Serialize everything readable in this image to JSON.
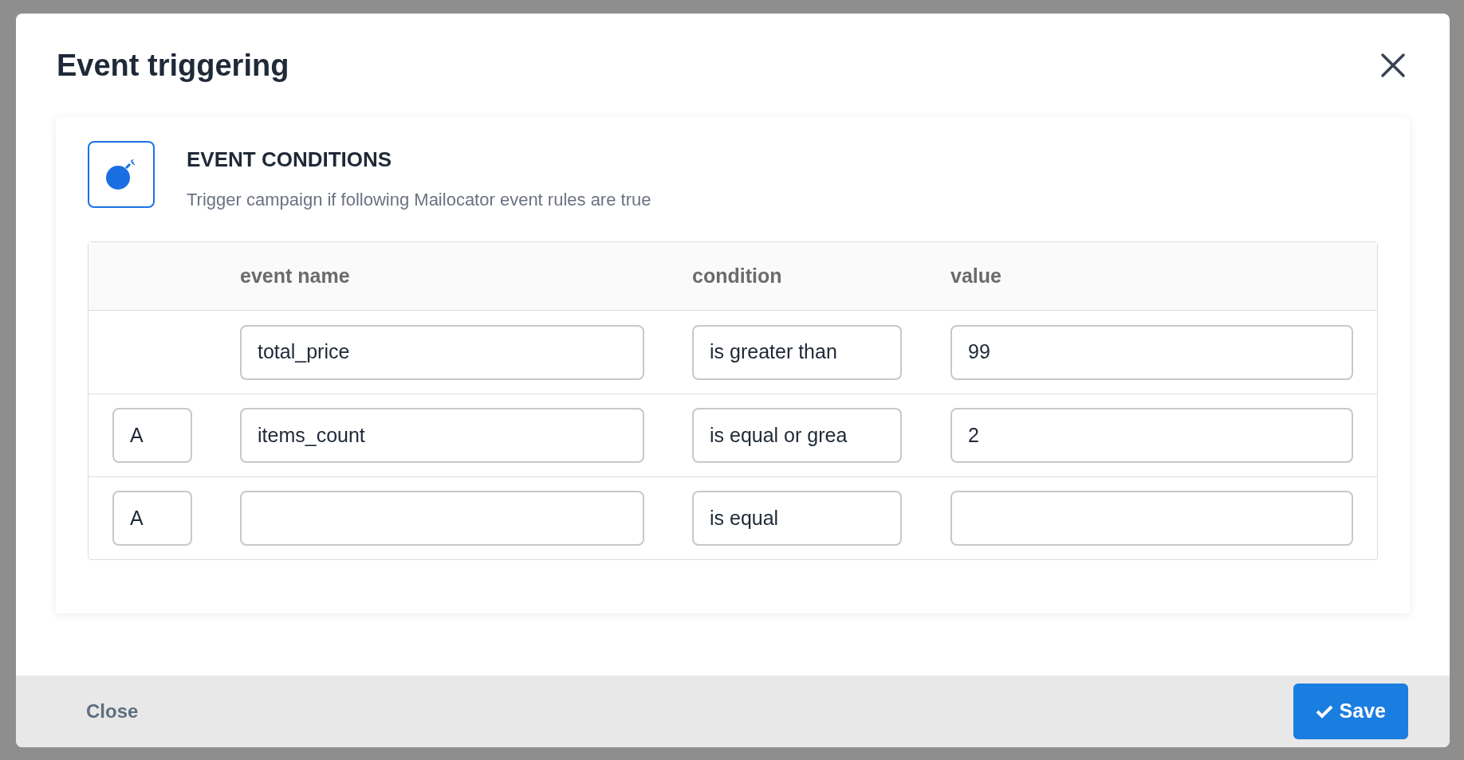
{
  "dialog": {
    "title": "Event triggering"
  },
  "section": {
    "title": "EVENT CONDITIONS",
    "description": "Trigger campaign if following Mailocator event rules are true"
  },
  "table": {
    "columns": [
      "event name",
      "condition",
      "value"
    ],
    "rows": [
      {
        "event_name": "total_price",
        "condition": "is greater than",
        "value": "99"
      },
      {
        "operator": "A",
        "event_name": "items_count",
        "condition": "is equal or grea",
        "value": "2"
      },
      {
        "operator": "A",
        "condition": "is equal"
      }
    ]
  },
  "footer": {
    "close": "Close",
    "save": "Save"
  }
}
